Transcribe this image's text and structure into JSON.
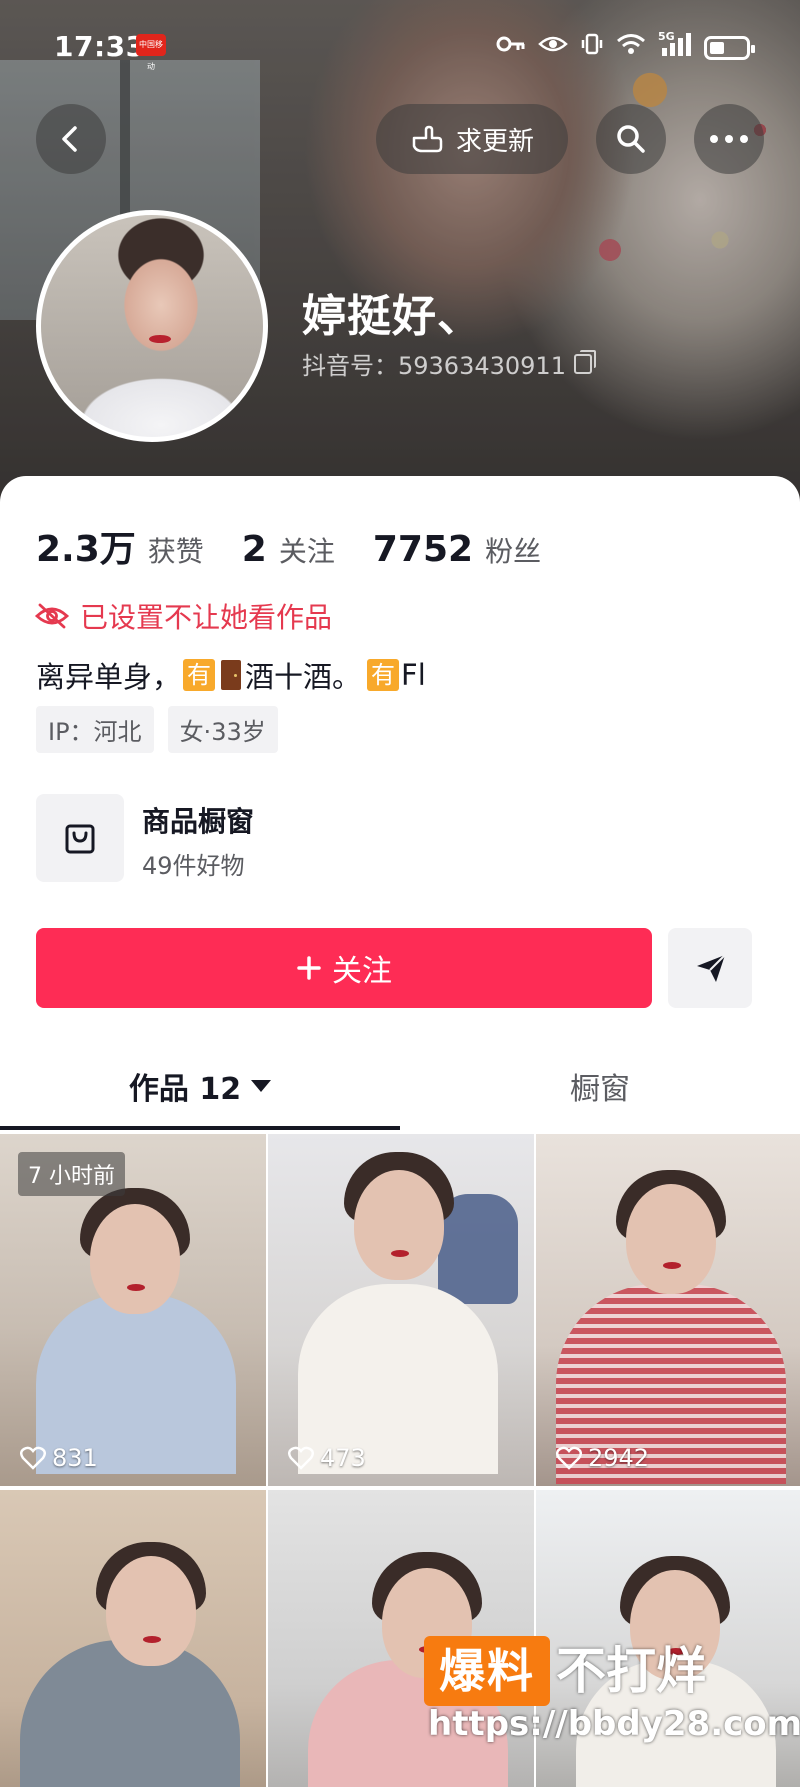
{
  "status_bar": {
    "time": "17:33",
    "carrier_badge": "中国移动",
    "network": "5G",
    "battery_percent": 40
  },
  "header": {
    "update_label": "求更新"
  },
  "profile": {
    "name": "婷挺好、",
    "douyin_id": "抖音号：59363430911",
    "stats": [
      {
        "value": "2.3万",
        "label": "获赞"
      },
      {
        "value": "2",
        "label": "关注"
      },
      {
        "value": "7752",
        "label": "粉丝"
      }
    ],
    "blocked_notice": "已设置不让她看作品",
    "bio": {
      "part1": "离异单身，",
      "tag1": "有",
      "part2": "酒十酒。",
      "tag2": "有",
      "part3": "Fl"
    },
    "chips": [
      "IP：河北",
      "女·33岁"
    ],
    "shop": {
      "title": "商品橱窗",
      "subtitle": "49件好物"
    },
    "follow_label": "关注"
  },
  "tabs": {
    "works_label": "作品 12",
    "showcase_label": "橱窗"
  },
  "videos": [
    {
      "likes": "831",
      "time_badge": "7 小时前"
    },
    {
      "likes": "473"
    },
    {
      "likes": "2942"
    },
    {},
    {},
    {}
  ],
  "watermark": {
    "box_text": "爆料",
    "big_text": "不打烊",
    "url": "https://bbdy28.com"
  },
  "colors": {
    "accent": "#fe2c55",
    "blocked": "#e5394f",
    "tag": "#f8a92b"
  }
}
